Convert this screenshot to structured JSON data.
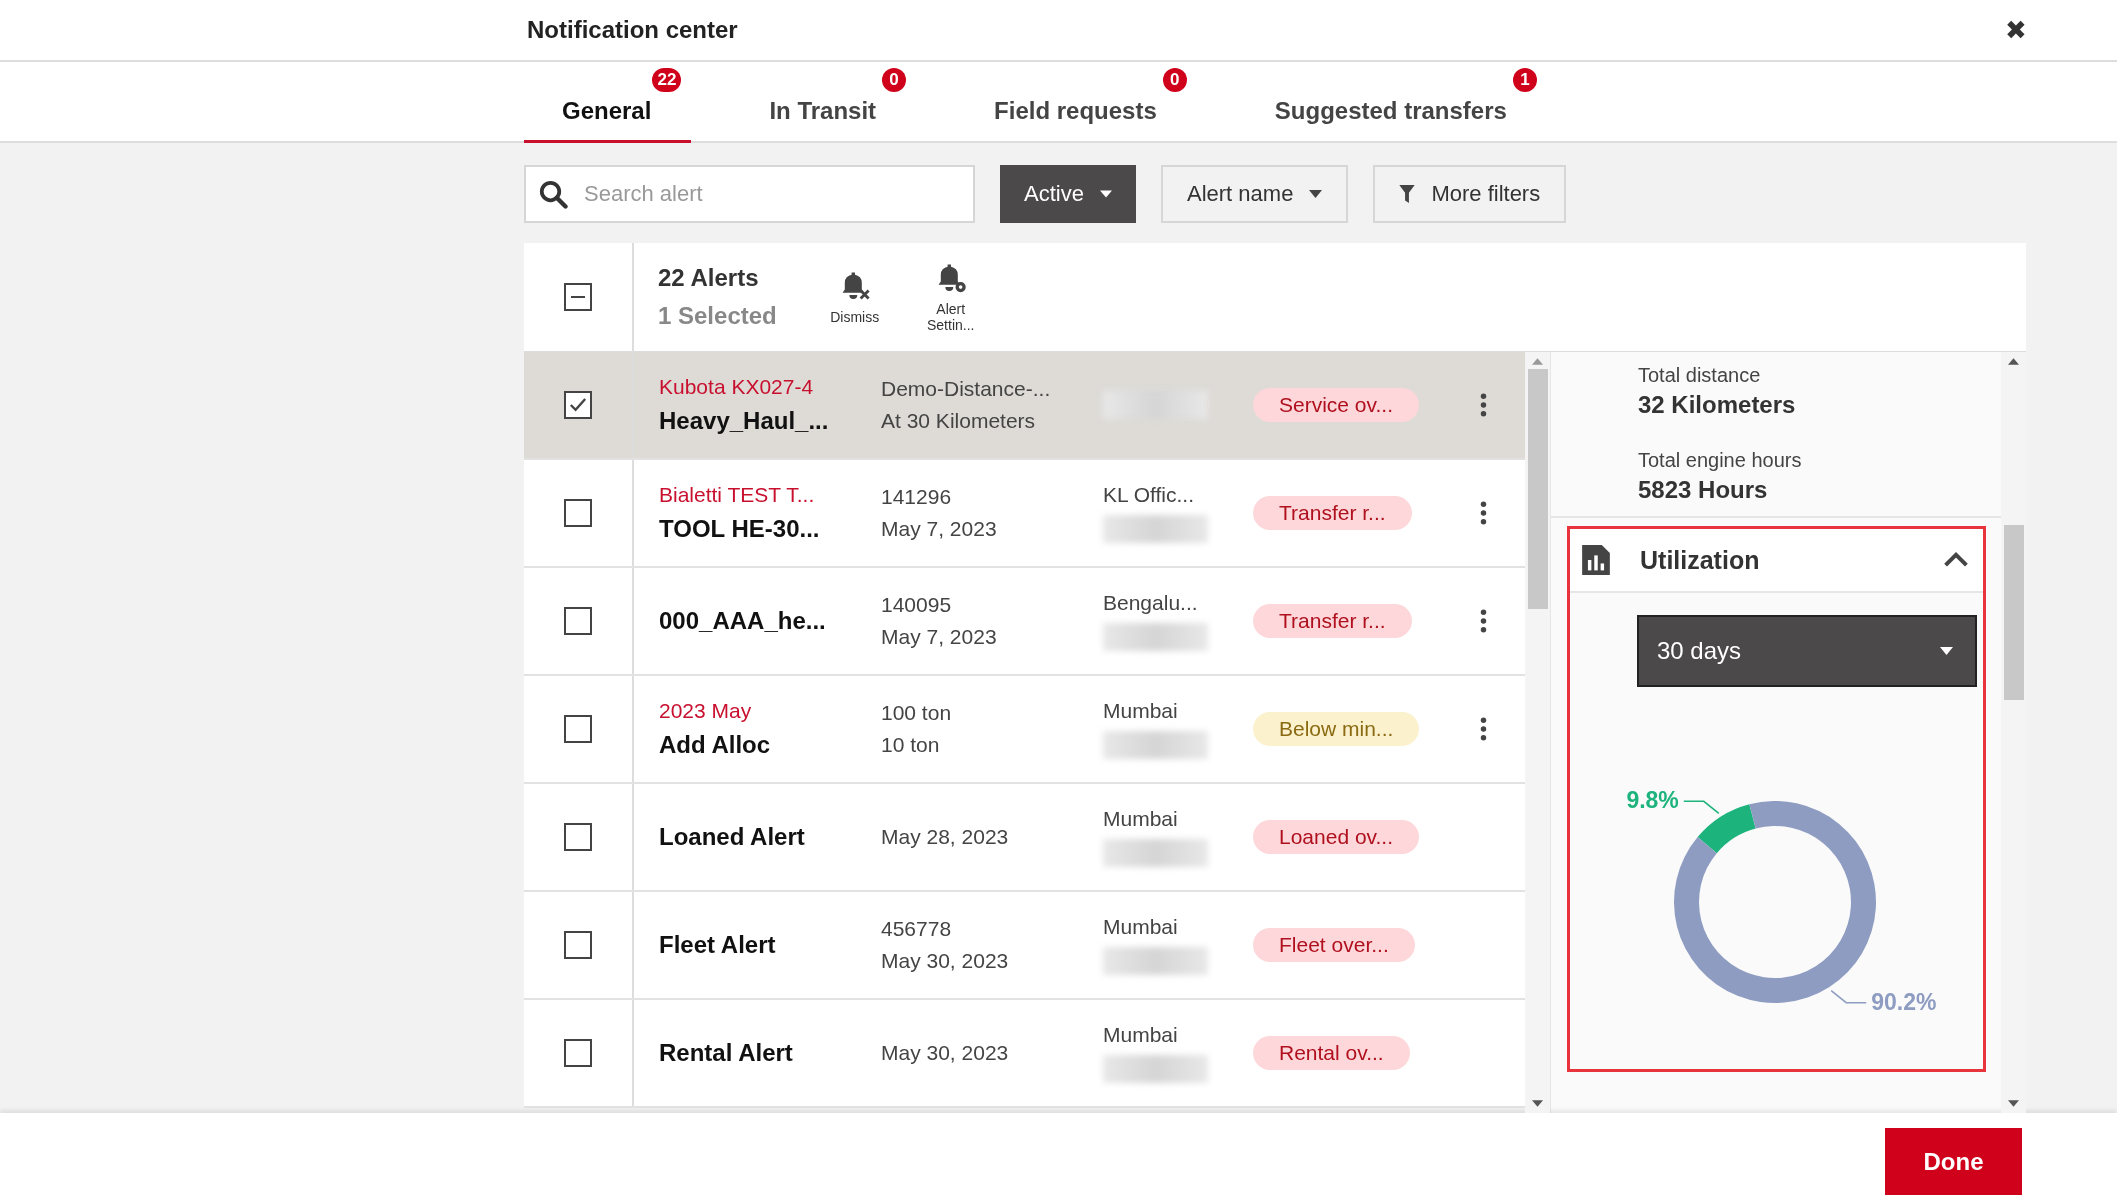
{
  "window": {
    "title": "Notification center",
    "close": "✖"
  },
  "tabs": [
    {
      "label": "General",
      "count": "22",
      "selected": true
    },
    {
      "label": "In Transit",
      "count": "0",
      "selected": false
    },
    {
      "label": "Field requests",
      "count": "0",
      "selected": false
    },
    {
      "label": "Suggested transfers",
      "count": "1",
      "selected": false
    }
  ],
  "search": {
    "placeholder": "Search alert"
  },
  "filters": [
    {
      "kind": "status",
      "label": "Active"
    },
    {
      "kind": "dropdown",
      "label": "Alert name"
    },
    {
      "kind": "more",
      "label": "More filters"
    }
  ],
  "list_header": {
    "count": "22 Alerts",
    "selected_count": "1 Selected",
    "select_all_indeterminate": true,
    "actions": [
      {
        "kind": "dismiss",
        "label": "Dismiss"
      },
      {
        "kind": "settings",
        "label": "Alert Settin..."
      }
    ]
  },
  "rows": [
    {
      "selected": true,
      "checked": true,
      "asset": "Kubota KX027-4",
      "name": "Heavy_Haul_...",
      "detail_1": "Demo-Distance-...",
      "detail_2": "At 30 Kilometers",
      "tag": "Service ov...",
      "kind": "alert",
      "menu": true
    },
    {
      "selected": false,
      "checked": false,
      "asset": "Bialetti TEST T...",
      "name": "TOOL HE-30...",
      "detail_1": "141296",
      "detail_2": "May 7, 2023",
      "location": "KL Offic...",
      "tag": "Transfer r...",
      "kind": "alert",
      "menu": true
    },
    {
      "selected": false,
      "checked": false,
      "name": "000_AAA_he...",
      "detail_1": "140095",
      "detail_2": "May 7, 2023",
      "location": "Bengalu...",
      "tag": "Transfer r...",
      "kind": "alert",
      "menu": true
    },
    {
      "selected": false,
      "checked": false,
      "asset": "2023 May",
      "name": "Add Alloc",
      "detail_1": "100 ton",
      "detail_2": "10 ton",
      "location": "Mumbai",
      "tag": "Below min...",
      "kind": "warning",
      "menu": true
    },
    {
      "selected": false,
      "checked": false,
      "name": "Loaned Alert",
      "detail_2": "May 28, 2023",
      "location": "Mumbai",
      "tag": "Loaned ov...",
      "kind": "alert",
      "menu": false
    },
    {
      "selected": false,
      "checked": false,
      "name": "Fleet Alert",
      "detail_1": "456778",
      "detail_2": "May 30, 2023",
      "location": "Mumbai",
      "tag": "Fleet over...",
      "kind": "alert",
      "menu": false
    },
    {
      "selected": false,
      "checked": false,
      "name": "Rental Alert",
      "detail_2": "May 30, 2023",
      "location": "Mumbai",
      "tag": "Rental ov...",
      "kind": "alert",
      "menu": false
    }
  ],
  "details": {
    "stats": [
      {
        "label": "Total distance",
        "value": "32 Kilometers"
      },
      {
        "label": "Total engine hours",
        "value": "5823 Hours"
      }
    ],
    "utilization": {
      "title": "Utilization",
      "expanded": true,
      "highlighted": true,
      "period": "30 days",
      "chart_data": {
        "type": "donut",
        "values": [
          9.8,
          90.2
        ],
        "colors": [
          "#1cb47c",
          "#8e9cc2"
        ],
        "value_labels": [
          "9.8%",
          "90.2%"
        ]
      }
    }
  },
  "footer": {
    "done": "Done"
  }
}
